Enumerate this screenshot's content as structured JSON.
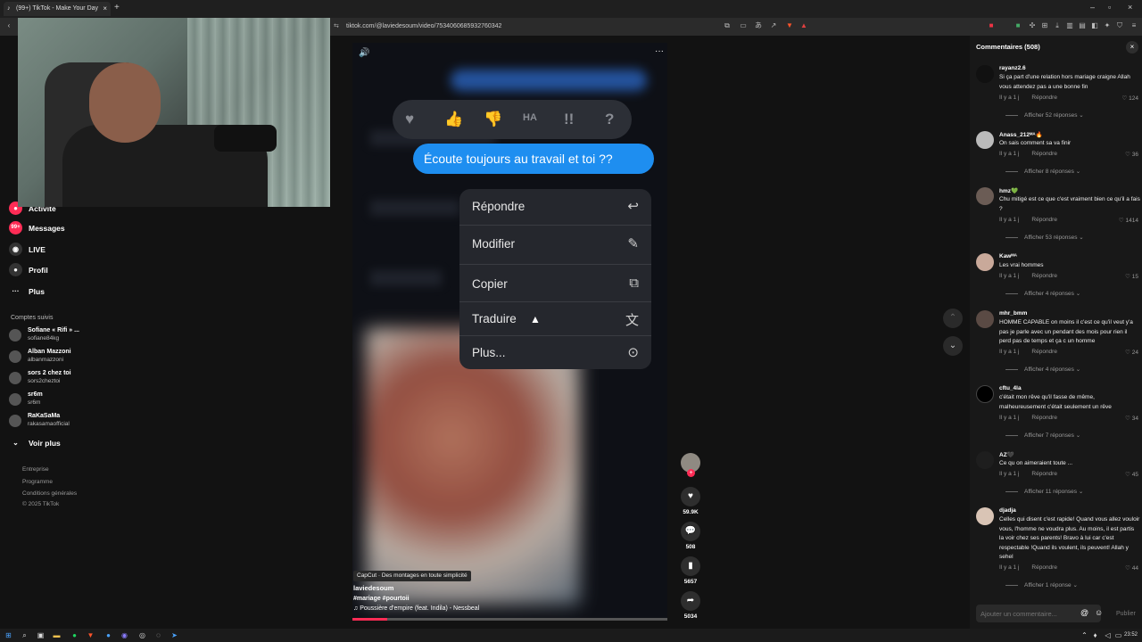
{
  "browser": {
    "tab_title": "(99+) TikTok - Make Your Day",
    "url": "tiktok.com/@laviedesoum/video/7534060685932760342"
  },
  "sidebar": {
    "nav": [
      {
        "label": "Activité",
        "icon": "bell-icon"
      },
      {
        "label": "Messages",
        "icon": "message-icon",
        "badge": "99+"
      },
      {
        "label": "LIVE",
        "icon": "live-icon"
      },
      {
        "label": "Profil",
        "icon": "profile-icon"
      },
      {
        "label": "Plus",
        "icon": "more-icon"
      }
    ],
    "following_title": "Comptes suivis",
    "following": [
      {
        "name": "Sofiane « Rifi » ...",
        "handle": "sofiane84kg"
      },
      {
        "name": "Alban Mazzoni",
        "handle": "albanmazzoni"
      },
      {
        "name": "sors 2 chez toi",
        "handle": "sors2cheztoi"
      },
      {
        "name": "sr6m",
        "handle": "sr6m"
      },
      {
        "name": "RaKaSaMa",
        "handle": "rakasamaofficial"
      }
    ],
    "see_more": "Voir plus",
    "footer": [
      "Entreprise",
      "Programme",
      "Conditions générales",
      "© 2025 TikTok"
    ]
  },
  "video": {
    "message": "Écoute toujours au travail et toi ??",
    "menu": [
      {
        "label": "Répondre",
        "icon": "reply-icon"
      },
      {
        "label": "Modifier",
        "icon": "edit-icon"
      },
      {
        "label": "Copier",
        "icon": "copy-icon"
      },
      {
        "label": "Traduire",
        "icon": "translate-icon"
      },
      {
        "label": "Plus...",
        "icon": "more-circle-icon"
      }
    ],
    "capcut": "CapCut · Des montages en toute simplicité",
    "author": "laviedesoum",
    "hashtags": "#mariage #pourtoii",
    "music": "♫ Poussière d'empire (feat. Indila) - Nessbeal",
    "progress": 0.11
  },
  "actions": {
    "likes": "59.9K",
    "comments": "508",
    "saves": "5657",
    "shares": "5034"
  },
  "comments_panel": {
    "title": "Commentaires (508)",
    "time": "Il y a 1 j",
    "reply_label": "Répondre",
    "input_placeholder": "Ajouter un commentaire...",
    "post_label": "Publier",
    "items": [
      {
        "user": "rayanz2.6",
        "text": "Si ça part d'une relation hors mariage craigne Allah vous attendez pas a une bonne fin",
        "likes": "124",
        "more": "Afficher 52 réponses"
      },
      {
        "user": "Anass_212ᴹᴬ🔥",
        "text": "On sais comment sa va finir",
        "likes": "36",
        "more": "Afficher 8 réponses"
      },
      {
        "user": "hmz💚",
        "text": "Chu mitigé est ce que c'est vraiment bien ce qu'il a fais ?",
        "likes": "1414",
        "more": "Afficher 53 réponses"
      },
      {
        "user": "Kawᴹᴬ",
        "text": "Les vrai hommes",
        "likes": "15",
        "more": "Afficher 4 réponses"
      },
      {
        "user": "mhr_bmm",
        "text": "HOMME CAPABLE on moins il c'est ce qu'il veut y'a pas je parle avec un pendant des mois pour rien il perd pas de temps et ça c un homme",
        "likes": "24",
        "more": "Afficher 4 réponses"
      },
      {
        "user": "cftu_4la",
        "text": "c'était mon rêve qu'il fasse de même, malheureusement c'était seulement un rêve",
        "likes": "34",
        "more": "Afficher 7 réponses"
      },
      {
        "user": "AZ🖤",
        "text": "Ce qu on aimeraient toute ...",
        "likes": "45",
        "more": "Afficher 11 réponses"
      },
      {
        "user": "djadja",
        "text": "Celles qui disent c'est rapide! Quand vous allez vouloir vous, l'homme ne voudra plus. Au moins, il est partis la voir chez ses parents! Bravo à lui car c'est respectable !Quand ils voulent, ils peuvent! Allah y sehel",
        "likes": "44",
        "more": "Afficher 1 réponse"
      }
    ]
  },
  "taskbar": {
    "clock": "23:52"
  }
}
